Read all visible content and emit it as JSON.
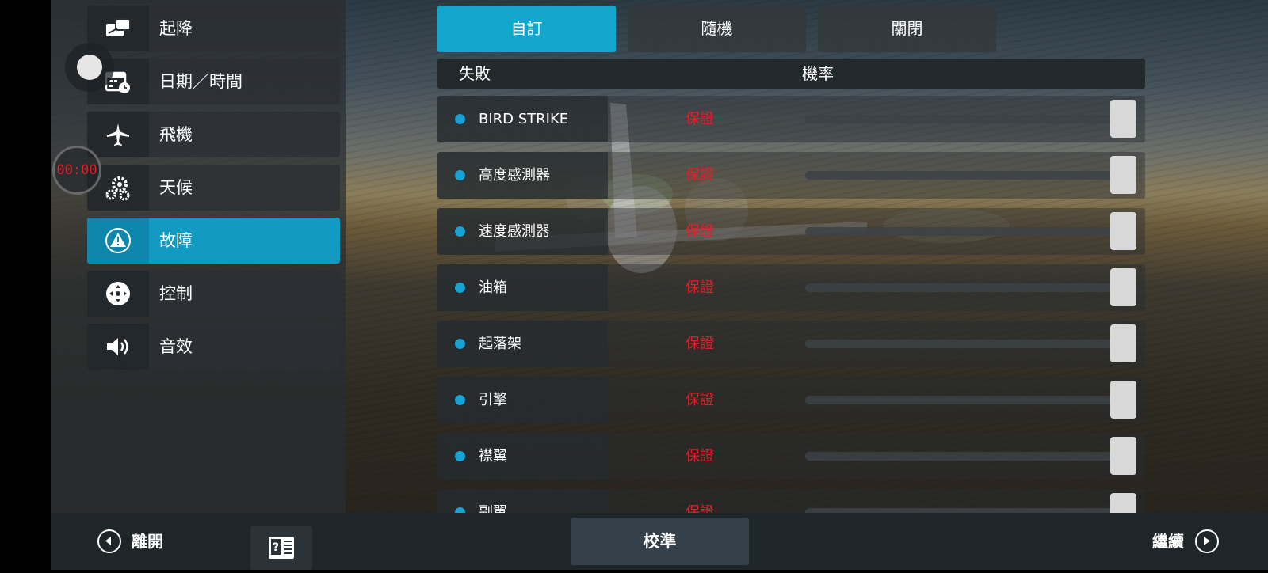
{
  "sidebar": {
    "items": [
      {
        "label": "起降",
        "icon": "takeoff-landing-icon"
      },
      {
        "label": "日期／時間",
        "icon": "calendar-clock-icon"
      },
      {
        "label": "飛機",
        "icon": "airplane-icon"
      },
      {
        "label": "天候",
        "icon": "weather-gears-icon"
      },
      {
        "label": "故障",
        "icon": "warning-icon",
        "active": true
      },
      {
        "label": "控制",
        "icon": "dpad-control-icon"
      },
      {
        "label": "音效",
        "icon": "speaker-icon"
      }
    ]
  },
  "timer": "00:00",
  "tabs": [
    {
      "label": "自訂",
      "active": true
    },
    {
      "label": "隨機"
    },
    {
      "label": "關閉"
    }
  ],
  "table": {
    "headers": {
      "failure": "失敗",
      "probability": "機率"
    },
    "rows": [
      {
        "name": "BIRD STRIKE",
        "probability": "保證"
      },
      {
        "name": "高度感測器",
        "probability": "保證"
      },
      {
        "name": "速度感測器",
        "probability": "保證"
      },
      {
        "name": "油箱",
        "probability": "保證"
      },
      {
        "name": "起落架",
        "probability": "保證"
      },
      {
        "name": "引擎",
        "probability": "保證"
      },
      {
        "name": "襟翼",
        "probability": "保證"
      },
      {
        "name": "副翼",
        "probability": "保證"
      }
    ]
  },
  "bottom": {
    "exit_label": "離開",
    "calibrate_label": "校準",
    "continue_label": "繼續",
    "manual_icon": "manual-help-icon"
  },
  "colors": {
    "accent": "#13a6cc",
    "probability_text": "#e0202a",
    "dot": "#18a3d4"
  }
}
